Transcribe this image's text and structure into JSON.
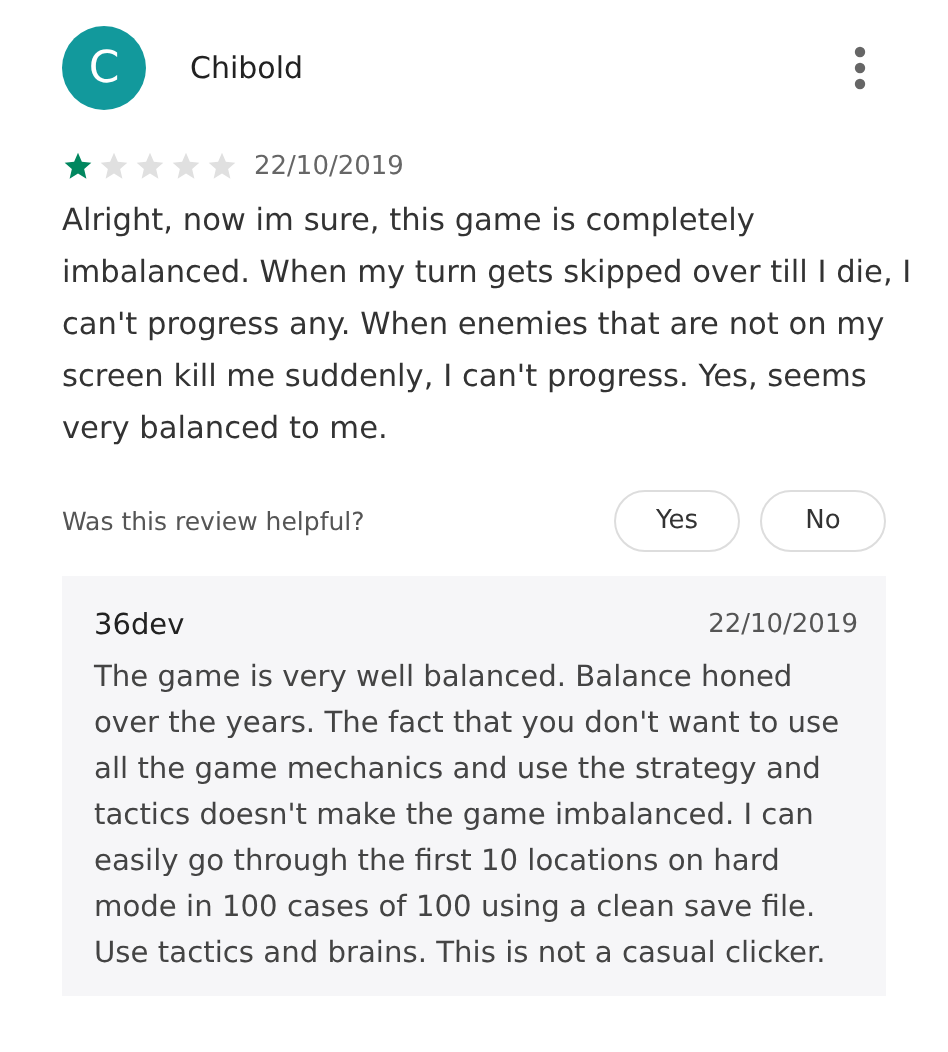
{
  "review": {
    "avatar_letter": "C",
    "author": "Chibold",
    "stars": 1,
    "date": "22/10/2019",
    "text": "Alright, now im sure, this game is completely imbalanced. When my turn gets skipped over till I die, I can't progress any. When enemies that are not on my screen kill me suddenly, I can't progress. Yes, seems very balanced to me."
  },
  "helpful": {
    "question": "Was this review helpful?",
    "buttons": [
      "Yes",
      "No"
    ]
  },
  "reply": {
    "author": "36dev",
    "date": "22/10/2019",
    "text": "The game is very well balanced. Balance honed over the years. The fact that you don't want to use all the game mechanics and use the strategy and tactics doesn't make the game imbalanced. I can easily go through the first 10 locations on hard mode in 100 cases of 100 using a clean save file. Use tactics and brains. This is not a casual clicker."
  }
}
